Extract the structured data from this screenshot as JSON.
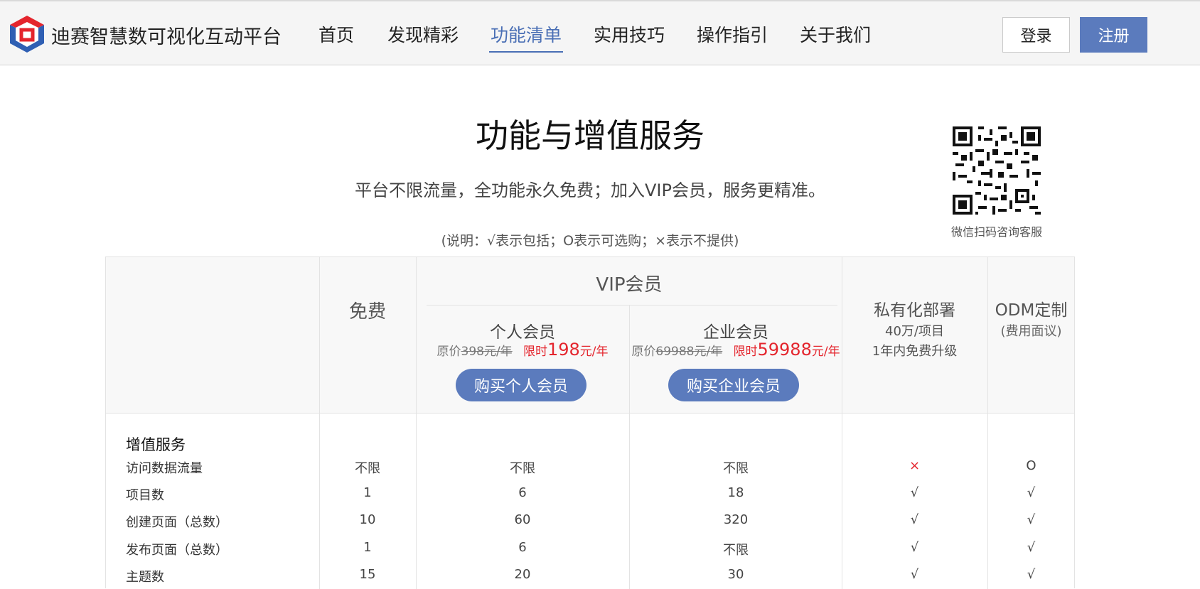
{
  "header": {
    "brand": "迪赛智慧数可视化互动平台",
    "nav": [
      "首页",
      "发现精彩",
      "功能清单",
      "实用技巧",
      "操作指引",
      "关于我们"
    ],
    "login": "登录",
    "register": "注册",
    "accent": "#5b7bbd"
  },
  "hero": {
    "title": "功能与增值服务",
    "subtitle": "平台不限流量，全功能永久免费；加入VIP会员，服务更精准。",
    "legend": "(说明：√表示包括；O表示可选购；×表示不提供)"
  },
  "qr": {
    "caption": "微信扫码咨询客服"
  },
  "plans": {
    "free": "免费",
    "vip": "VIP会员",
    "personal": {
      "name": "个人会员",
      "orig_prefix": "原价",
      "orig_price": "398元/年",
      "sale_prefix": "限时",
      "sale_price": "198",
      "sale_unit": "元/年",
      "button": "购买个人会员"
    },
    "enterprise": {
      "name": "企业会员",
      "orig_prefix": "原价",
      "orig_price": "69988元/年",
      "sale_prefix": "限时",
      "sale_price": "59988",
      "sale_unit": "元/年",
      "button": "购买企业会员"
    },
    "private": {
      "name": "私有化部署",
      "price": "40万/项目",
      "note": "1年内免费升级"
    },
    "odm": {
      "name": "ODM定制",
      "note": "(费用面议)"
    }
  },
  "section": {
    "title": "增值服务",
    "rows": [
      {
        "label": "访问数据流量",
        "free": "不限",
        "personal": "不限",
        "enterprise": "不限",
        "private": "×",
        "odm": "O"
      },
      {
        "label": "项目数",
        "free": "1",
        "personal": "6",
        "enterprise": "18",
        "private": "√",
        "odm": "√"
      },
      {
        "label": "创建页面（总数）",
        "free": "10",
        "personal": "60",
        "enterprise": "320",
        "private": "√",
        "odm": "√"
      },
      {
        "label": "发布页面（总数）",
        "free": "1",
        "personal": "6",
        "enterprise": "不限",
        "private": "√",
        "odm": "√"
      },
      {
        "label": "主题数",
        "free": "15",
        "personal": "20",
        "enterprise": "30",
        "private": "√",
        "odm": "√"
      }
    ]
  }
}
